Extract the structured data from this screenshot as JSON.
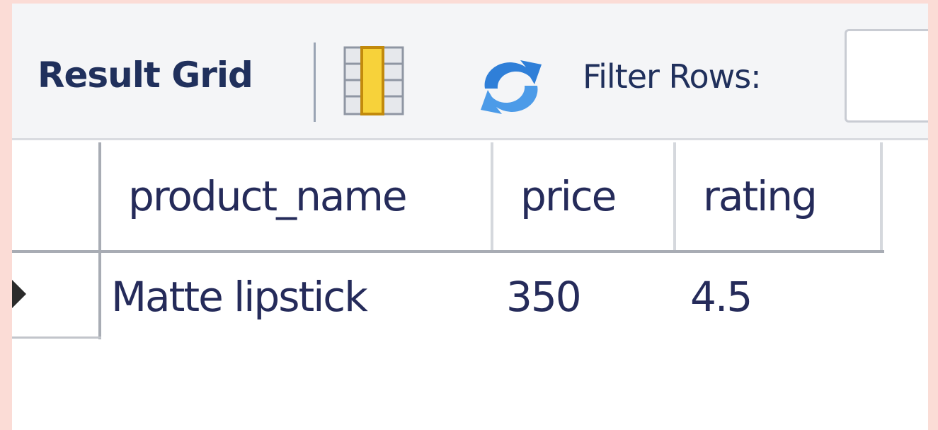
{
  "toolbar": {
    "result_grid_label": "Result Grid",
    "grid_icon": "grid-layout-icon",
    "refresh_icon": "refresh-icon",
    "filter_label": "Filter Rows:",
    "filter_value": ""
  },
  "table": {
    "columns": [
      "product_name",
      "price",
      "rating"
    ],
    "rows": [
      {
        "product_name": "Matte lipstick",
        "price": "350",
        "rating": "4.5"
      }
    ]
  },
  "colors": {
    "page_background": "#fbdcd6",
    "label_text": "#20305c",
    "grid_icon_accent": "#f7d23a",
    "refresh_icon": "#2f7fd8"
  }
}
